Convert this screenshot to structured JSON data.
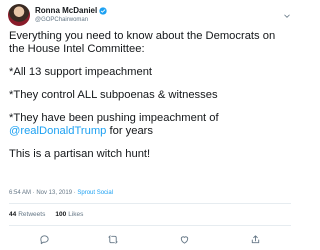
{
  "tweet": {
    "author_name": "Ronna McDaniel",
    "author_handle": "@GOPChairwoman",
    "lines": {
      "line1": "Everything you need to know about the Democrats on",
      "line2": "the House Intel Committee:",
      "line3": "*All 13 support impeachment",
      "line4": "*They control ALL subpoenas & witnesses",
      "line5": "*They have been pushing impeachment of",
      "mention": "@realDonaldTrump",
      "line6_rest": " for years",
      "line7": "This is a partisan witch hunt!"
    },
    "timestamp": "6:54 AM · Nov 13, 2019 · ",
    "source": "Sprout Social",
    "retweets_count": "44",
    "retweets_label": "Retweets",
    "likes_count": "100",
    "likes_label": "Likes"
  },
  "colors": {
    "accent": "#1da1f2",
    "text": "#14171a",
    "muted": "#657786",
    "divider": "#e6ecf0"
  },
  "icons": [
    "verified-badge-icon",
    "chevron-down-icon",
    "reply-icon",
    "retweet-icon",
    "like-icon",
    "share-icon"
  ]
}
